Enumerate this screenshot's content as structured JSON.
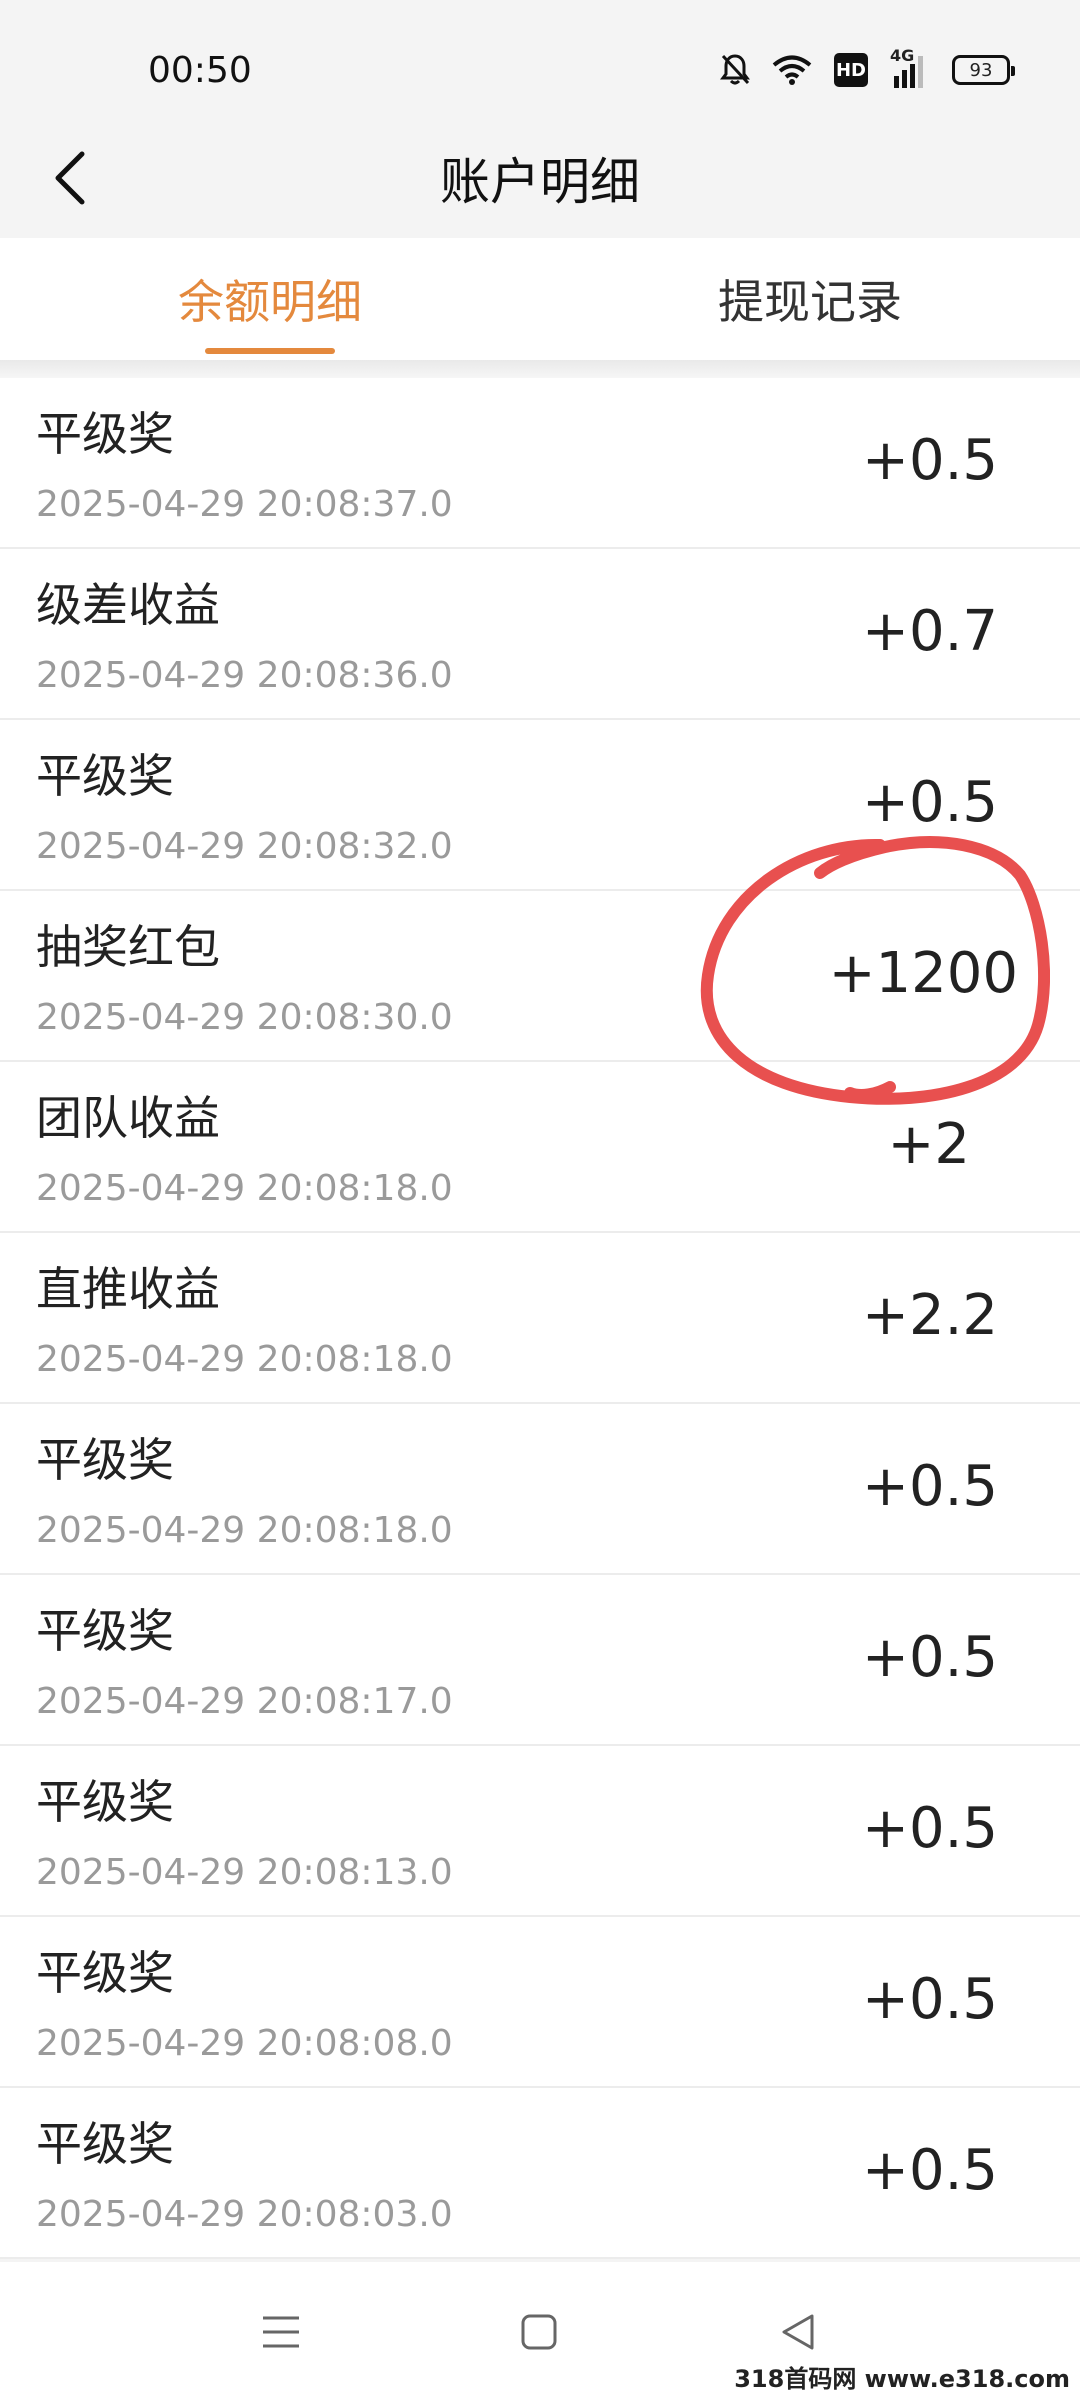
{
  "status_bar": {
    "time": "00:50",
    "battery": "93",
    "network": "4G",
    "hd": "HD",
    "icons": [
      "bell-off-icon",
      "wifi-icon",
      "hd-icon",
      "signal-4g-icon",
      "battery-icon"
    ]
  },
  "header": {
    "title": "账户明细",
    "back_icon": "chevron-left-icon"
  },
  "tabs": [
    {
      "label": "余额明细",
      "active": true
    },
    {
      "label": "提现记录",
      "active": false
    }
  ],
  "records": [
    {
      "title": "平级奖",
      "time": "2025-04-29 20:08:37.0",
      "amount": "+0.5"
    },
    {
      "title": "级差收益",
      "time": "2025-04-29 20:08:36.0",
      "amount": "+0.7"
    },
    {
      "title": "平级奖",
      "time": "2025-04-29 20:08:32.0",
      "amount": "+0.5"
    },
    {
      "title": "抽奖红包",
      "time": "2025-04-29 20:08:30.0",
      "amount": "+1200"
    },
    {
      "title": "团队收益",
      "time": "2025-04-29 20:08:18.0",
      "amount": "+2"
    },
    {
      "title": "直推收益",
      "time": "2025-04-29 20:08:18.0",
      "amount": "+2.2"
    },
    {
      "title": "平级奖",
      "time": "2025-04-29 20:08:18.0",
      "amount": "+0.5"
    },
    {
      "title": "平级奖",
      "time": "2025-04-29 20:08:17.0",
      "amount": "+0.5"
    },
    {
      "title": "平级奖",
      "time": "2025-04-29 20:08:13.0",
      "amount": "+0.5"
    },
    {
      "title": "平级奖",
      "time": "2025-04-29 20:08:08.0",
      "amount": "+0.5"
    },
    {
      "title": "平级奖",
      "time": "2025-04-29 20:08:03.0",
      "amount": "+0.5"
    }
  ],
  "annotation": {
    "color": "#e8504f"
  },
  "colors": {
    "accent": "#e4893d"
  },
  "nav_bar": {
    "icons": [
      "menu-icon",
      "home-square-icon",
      "back-triangle-icon"
    ]
  },
  "watermark": "318首码网 www.e318.com"
}
